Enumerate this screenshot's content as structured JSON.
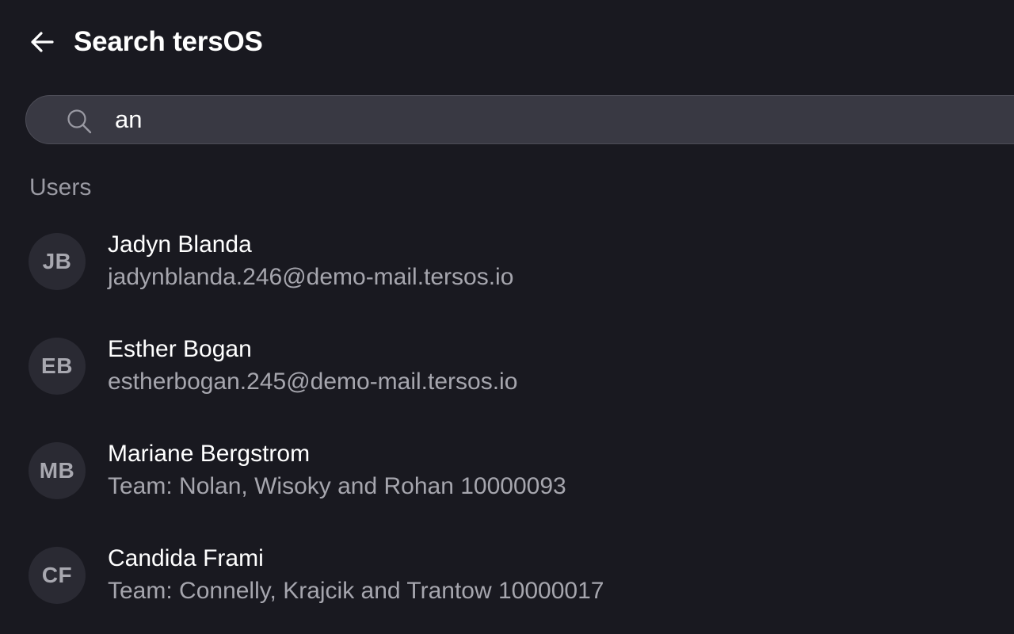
{
  "header": {
    "title": "Search tersOS",
    "back_icon": "arrow-left-icon"
  },
  "search": {
    "value": "an",
    "icon": "search-icon"
  },
  "results": {
    "section_label": "Users",
    "users": [
      {
        "initials": "JB",
        "name": "Jadyn Blanda",
        "subtitle": "jadynblanda.246@demo-mail.tersos.io"
      },
      {
        "initials": "EB",
        "name": "Esther Bogan",
        "subtitle": "estherbogan.245@demo-mail.tersos.io"
      },
      {
        "initials": "MB",
        "name": "Mariane Bergstrom",
        "subtitle": "Team: Nolan, Wisoky and Rohan 10000093"
      },
      {
        "initials": "CF",
        "name": "Candida Frami",
        "subtitle": "Team: Connelly, Krajcik and Trantow 10000017"
      }
    ]
  },
  "colors": {
    "background": "#191920",
    "search_background": "#393943",
    "avatar_background": "#2a2a33",
    "primary_text": "#ffffff",
    "secondary_text": "#a6a6ae"
  }
}
